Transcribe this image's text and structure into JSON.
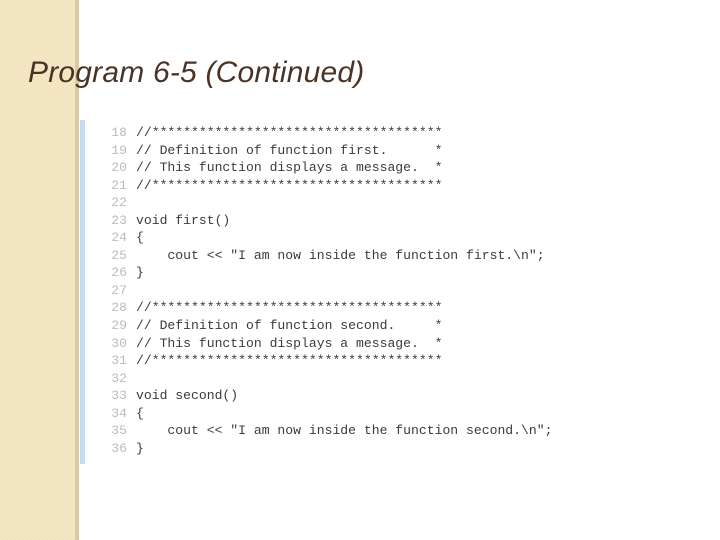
{
  "slide": {
    "title": "Program 6-5 (Continued)",
    "accent_sidebar_color": "#f0e0b4",
    "accent_sidebar_edge_color": "#d8cba0",
    "accent_rule_color": "#c5ddf2",
    "title_color": "#4a3322",
    "code_color": "#3b3b3b",
    "line_number_color": "#b9bcc0",
    "background_color": "#ffffff"
  },
  "code": {
    "lines": [
      {
        "n": "18",
        "text": "//*************************************"
      },
      {
        "n": "19",
        "text": "// Definition of function first.      *"
      },
      {
        "n": "20",
        "text": "// This function displays a message.  *"
      },
      {
        "n": "21",
        "text": "//*************************************"
      },
      {
        "n": "22",
        "text": ""
      },
      {
        "n": "23",
        "text": "void first()"
      },
      {
        "n": "24",
        "text": "{"
      },
      {
        "n": "25",
        "text": "    cout << \"I am now inside the function first.\\n\";"
      },
      {
        "n": "26",
        "text": "}"
      },
      {
        "n": "27",
        "text": ""
      },
      {
        "n": "28",
        "text": "//*************************************"
      },
      {
        "n": "29",
        "text": "// Definition of function second.     *"
      },
      {
        "n": "30",
        "text": "// This function displays a message.  *"
      },
      {
        "n": "31",
        "text": "//*************************************"
      },
      {
        "n": "32",
        "text": ""
      },
      {
        "n": "33",
        "text": "void second()"
      },
      {
        "n": "34",
        "text": "{"
      },
      {
        "n": "35",
        "text": "    cout << \"I am now inside the function second.\\n\";"
      },
      {
        "n": "36",
        "text": "}"
      }
    ]
  }
}
